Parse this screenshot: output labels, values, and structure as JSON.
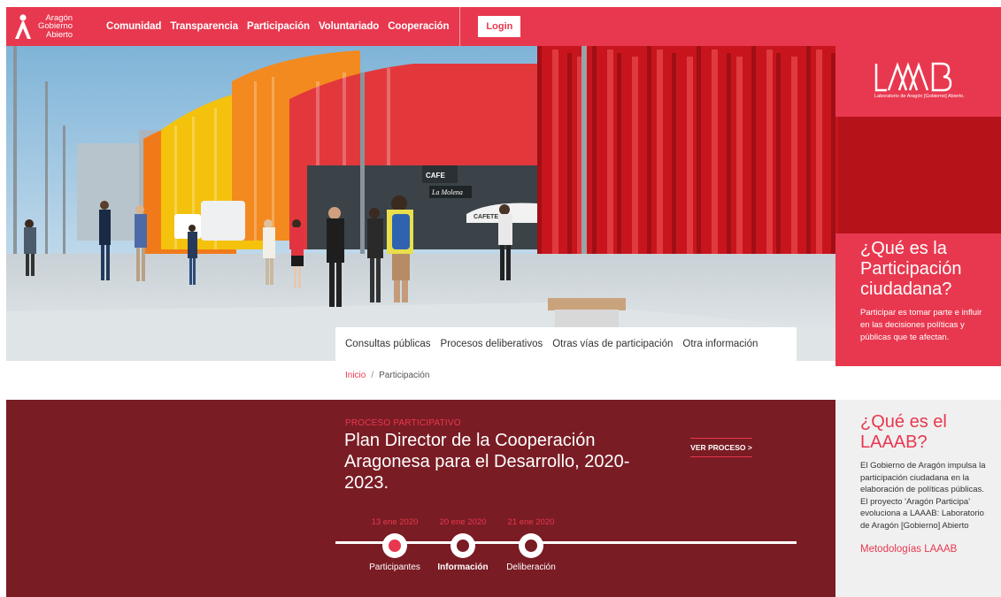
{
  "colors": {
    "brand_red": "#e8384f",
    "dark_red": "#7a1c24"
  },
  "brand": {
    "line1": "Aragón",
    "line2": "Gobierno",
    "line3": "Abierto"
  },
  "nav": {
    "items": [
      "Comunidad",
      "Transparencia",
      "Participación",
      "Voluntariado",
      "Cooperación"
    ],
    "login_label": "Login"
  },
  "hero": {
    "cafe_sign": "La Molena",
    "cafe_label": "CAFE",
    "awning": "CAFETERÍA"
  },
  "laaab": {
    "logo_text": "LAAAB",
    "caption": "Laboratorio de Aragón [Gobierno] Abierto."
  },
  "que_es": {
    "title": "¿Qué es la Participación ciudadana?",
    "text": "Participar es tomar parte e influir en las decisiones políticas y públicas que te afectan."
  },
  "subnav": {
    "items": [
      "Consultas públicas",
      "Procesos deliberativos",
      "Otras vías de participación",
      "Otra información"
    ]
  },
  "breadcrumb": {
    "home": "Inicio",
    "separator": "/",
    "current": "Participación"
  },
  "proceso": {
    "label": "PROCESO PARTICIPATIVO",
    "title": "Plan Director de la Cooperación Aragonesa para el Desarrollo, 2020-2023.",
    "button": "VER PROCESO >",
    "steps": [
      {
        "date": "13 ene 2020",
        "label": "Participantes"
      },
      {
        "date": "20 ene 2020",
        "label": "Información"
      },
      {
        "date": "21 ene 2020",
        "label": "Deliberación"
      }
    ]
  },
  "info": {
    "title": "¿Qué es el LAAAB?",
    "text": "El Gobierno de Aragón impulsa la participación ciudadana en la elaboración de políticas públicas. El proyecto 'Aragón Participa' evoluciona a LAAAB: Laboratorio de Aragón [Gobierno] Abierto",
    "link": "Metodologías LAAAB"
  }
}
